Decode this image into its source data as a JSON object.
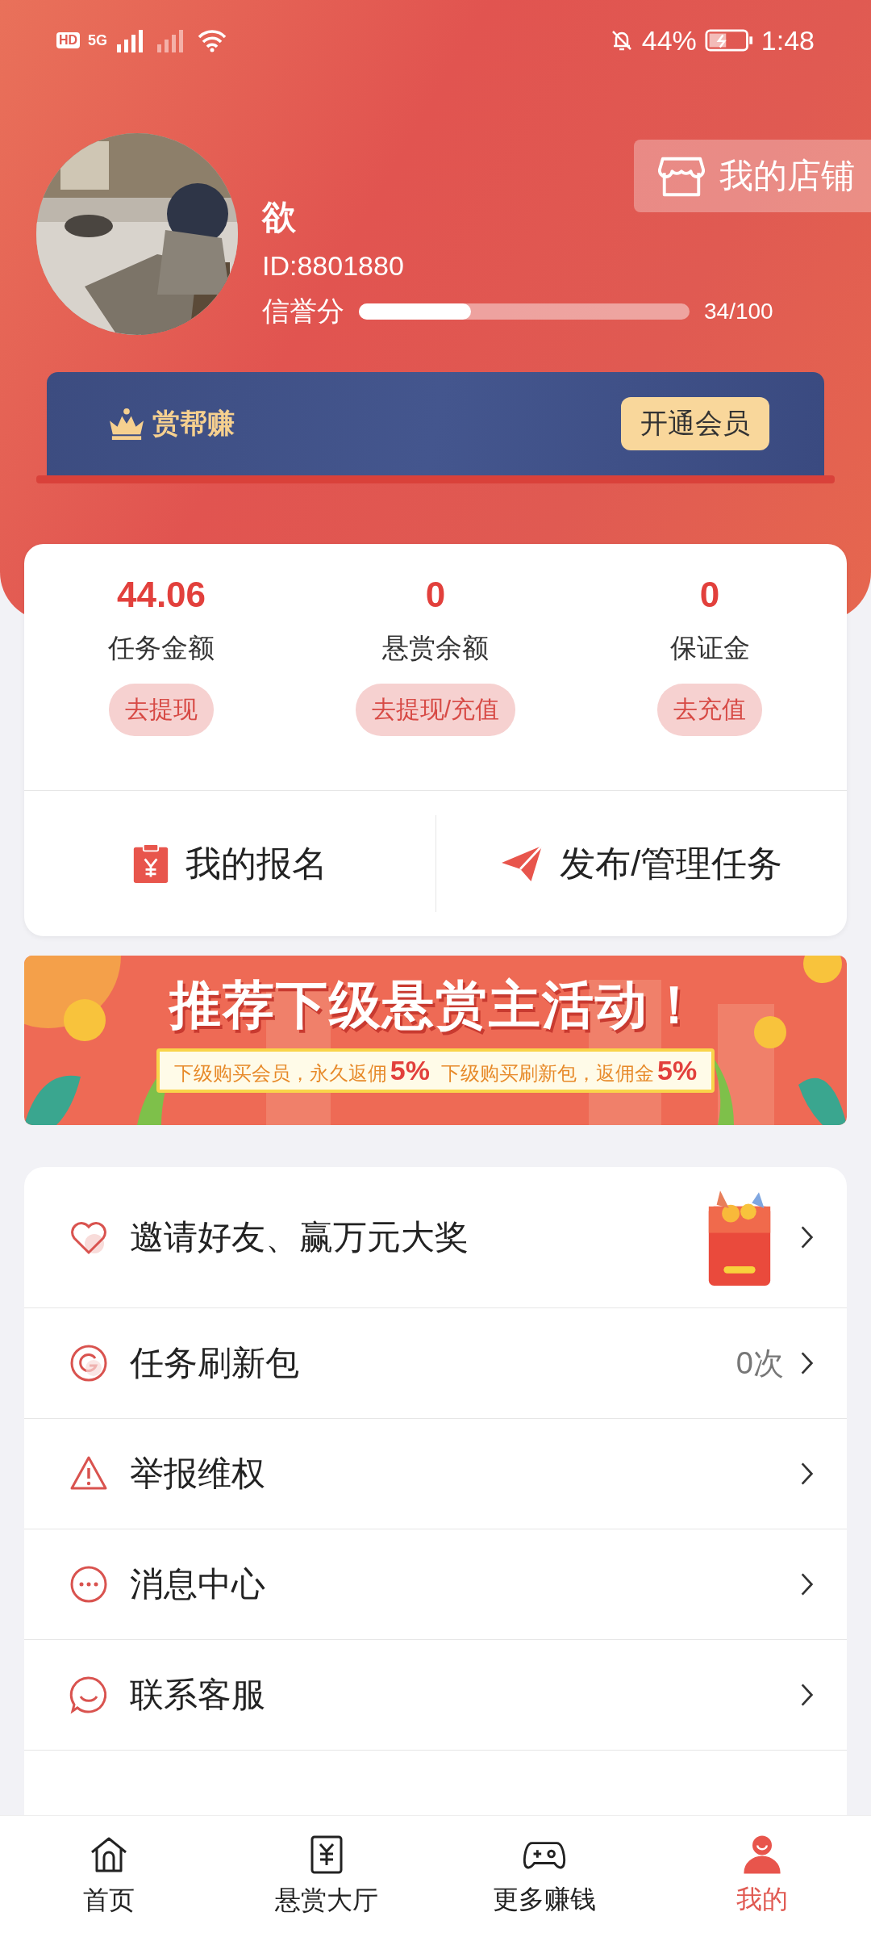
{
  "status_bar": {
    "network_labels": [
      "HD",
      "5G"
    ],
    "battery": "44%",
    "time": "1:48"
  },
  "profile": {
    "name": "欲",
    "id": "ID:8801880",
    "credit_label": "信誉分",
    "credit": {
      "level": 0.34
    },
    "credit_reading": "34/100"
  },
  "shop_button": "我的店铺",
  "vip_bar": {
    "title": "赏帮赚",
    "button": "开通会员"
  },
  "stats": [
    {
      "value": "44.06",
      "label": "任务金额",
      "action": "去提现"
    },
    {
      "value": "0",
      "label": "悬赏余额",
      "action": "去提现/充值"
    },
    {
      "value": "0",
      "label": "保证金",
      "action": "去充值"
    }
  ],
  "shortcuts": [
    {
      "kind": "signup",
      "label": "我的报名"
    },
    {
      "kind": "publish",
      "label": "发布/管理任务"
    }
  ],
  "banner": {
    "title": "推荐下级悬赏主活动！",
    "offers": [
      {
        "text": "下级购买会员，永久返佣",
        "rate": "5%"
      },
      {
        "text": "下级购买刷新包，返佣金",
        "rate": "5%"
      }
    ]
  },
  "menu": [
    {
      "kind": "heart",
      "label": "邀请好友、赢万元大奖",
      "picture": true
    },
    {
      "kind": "refresh",
      "label": "任务刷新包",
      "value": "0次",
      "picture": false
    },
    {
      "kind": "warning",
      "label": "举报维权",
      "picture": false
    },
    {
      "kind": "message",
      "label": "消息中心",
      "picture": false
    },
    {
      "kind": "service",
      "label": "联系客服",
      "picture": false
    }
  ],
  "bottom_nav": [
    {
      "kind": "home",
      "label": "首页",
      "selected": false
    },
    {
      "kind": "hall",
      "label": "悬赏大厅",
      "selected": false
    },
    {
      "kind": "game",
      "label": "更多赚钱",
      "selected": false
    },
    {
      "kind": "me",
      "label": "我的",
      "selected": true
    }
  ]
}
